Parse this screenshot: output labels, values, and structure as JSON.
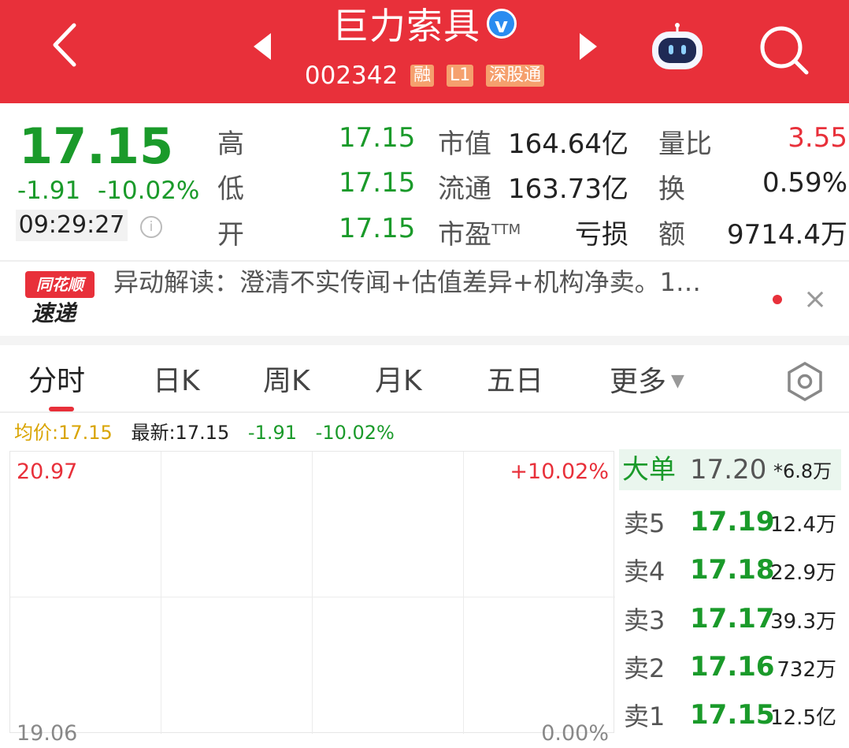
{
  "header": {
    "stock_name": "巨力索具",
    "verified_mark": "v",
    "stock_code": "002342",
    "tags": [
      "融",
      "L1",
      "深股通"
    ],
    "icons": {
      "back": "back-arrow-icon",
      "prev": "prev-stock-icon",
      "next": "next-stock-icon",
      "assistant": "robot-assistant-icon",
      "search": "search-icon"
    }
  },
  "quote": {
    "price": "17.15",
    "change": "-1.91",
    "change_pct": "-10.02%",
    "time": "09:29:27",
    "info_icon": "i",
    "high_label": "高",
    "high": "17.15",
    "low_label": "低",
    "low": "17.15",
    "open_label": "开",
    "open": "17.15",
    "mktcap_label": "市值",
    "mktcap": "164.64亿",
    "float_label": "流通",
    "float": "163.73亿",
    "pe_label": "市盈",
    "pe_suffix": "TTM",
    "pe": "亏损",
    "volratio_label": "量比",
    "volratio": "3.55",
    "turnover_label": "换",
    "turnover": "0.59%",
    "amount_label": "额",
    "amount": "9714.4万"
  },
  "news": {
    "logo_top": "同花顺",
    "logo_bottom": "速递",
    "text": "异动解读：澄清不实传闻+估值差异+机构净卖。1…",
    "close": "×"
  },
  "tabs": [
    "分时",
    "日K",
    "周K",
    "月K",
    "五日",
    "更多"
  ],
  "tab_more_arrow": "▼",
  "stats_line": {
    "avg_label": "均价:",
    "avg": "17.15",
    "latest_label": "最新:",
    "latest": "17.15",
    "change": "-1.91",
    "change_pct": "-10.02%"
  },
  "chart": {
    "top_price": "20.97",
    "top_pct": "+10.02%",
    "bottom_price": "19.06",
    "bottom_pct": "0.00%"
  },
  "orderbook": {
    "big": {
      "label": "大单",
      "price": "17.20",
      "vol": "*6.8万"
    },
    "asks": [
      {
        "label": "卖5",
        "price": "17.19",
        "vol": "12.4万"
      },
      {
        "label": "卖4",
        "price": "17.18",
        "vol": "22.9万"
      },
      {
        "label": "卖3",
        "price": "17.17",
        "vol": "39.3万"
      },
      {
        "label": "卖2",
        "price": "17.16",
        "vol": "732万"
      },
      {
        "label": "卖1",
        "price": "17.15",
        "vol": "12.5亿"
      }
    ]
  },
  "colors": {
    "header_red": "#e8303a",
    "down_green": "#1a9a2a",
    "up_red": "#e8303a",
    "avg_orange": "#d9a400"
  }
}
